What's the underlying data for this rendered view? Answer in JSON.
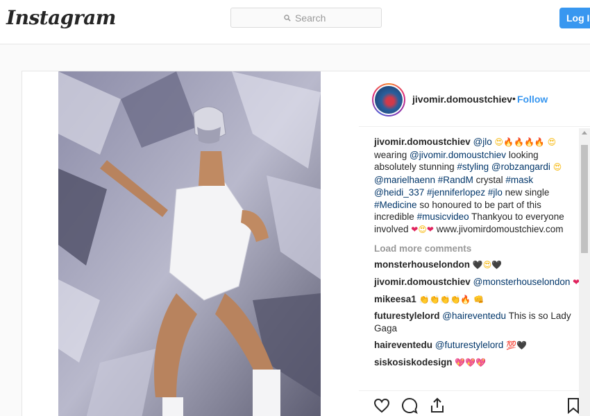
{
  "header": {
    "logo": "Instagram",
    "search_placeholder": "Search",
    "login_label": "Log In"
  },
  "post": {
    "username": "jivomir.domoustchiev",
    "dot": "•",
    "follow_label": "Follow",
    "caption": {
      "mention_jlo": "@jlo",
      "text_wearing": "wearing",
      "mention_self": "@jivomir.domoustchiev",
      "text_looking": "looking absolutely stunning",
      "tag_styling": "#styling",
      "mention_rob": "@robzangardi",
      "mention_mariel": "@marielhaenn",
      "tag_randm": "#RandM",
      "text_crystal": "crystal",
      "tag_mask": "#mask",
      "mention_heidi": "@heidi_337",
      "tag_jlo_full": "#jenniferlopez",
      "tag_jlo": "#jlo",
      "text_new_single": "new single",
      "tag_medicine": "#Medicine",
      "text_so_honoured": "so honoured to be part of this incredible",
      "tag_musicvideo": "#musicvideo",
      "text_thanks": "Thankyou to everyone involved",
      "website": "www.jivomirdomoustchiev.com"
    },
    "load_more": "Load more comments",
    "comments": [
      {
        "user": "monsterhouselondon",
        "text": ""
      },
      {
        "user": "jivomir.domoustchiev",
        "mention": "@monsterhouselondon",
        "text": ""
      },
      {
        "user": "mikeesa1",
        "text": ""
      },
      {
        "user": "futurestylelord",
        "mention": "@haireventedu",
        "text": "This is so Lady Gaga"
      },
      {
        "user": "haireventedu",
        "mention": "@futurestylelord",
        "text": ""
      },
      {
        "user": "siskosiskodesign",
        "text": ""
      }
    ],
    "emoji": {
      "fire": "🔥",
      "heart_eyes": "😍",
      "red_heart": "❤",
      "black_heart": "🖤",
      "clap": "👏",
      "fist": "👊",
      "hundred": "💯",
      "sparkle_heart": "💖"
    }
  },
  "icons": [
    "search-icon",
    "heart-icon",
    "comment-icon",
    "share-icon",
    "bookmark-icon"
  ],
  "colors": {
    "accent": "#3897f0",
    "link": "#003569",
    "border": "#e6e6e6",
    "muted": "#999999"
  }
}
